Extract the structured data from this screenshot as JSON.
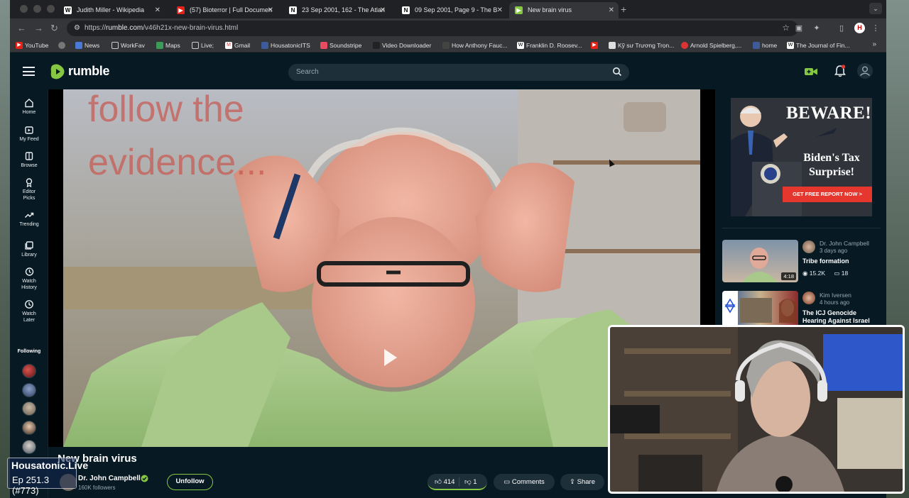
{
  "browser": {
    "tabs": [
      {
        "title": "Judith Miller - Wikipedia",
        "icon": "W"
      },
      {
        "title": "(57) Bioterror | Full Documen",
        "icon": "yt"
      },
      {
        "title": "23 Sep 2001, 162 - The Atlan",
        "icon": "N"
      },
      {
        "title": "09 Sep 2001, Page 9 - The B",
        "icon": "N"
      },
      {
        "title": "New brain virus",
        "icon": "rumble"
      }
    ],
    "url_prefix": "https://",
    "url_host": "rumble.com",
    "url_path": "/v46h21x-new-brain-virus.html",
    "profile_initial": "H",
    "bookmarks": [
      "YouTube",
      "",
      "News",
      "WorkFav",
      "Maps",
      "Live;",
      "Gmail",
      "HousatonicITS",
      "Soundstripe",
      "Video Downloader",
      "How Anthony Fauc...",
      "Franklin D. Roosev...",
      "",
      "Kỹ sư Trương Trọn...",
      "Arnold Spielberg,...",
      "home",
      "The Journal of Fin..."
    ]
  },
  "header": {
    "logo_text": "rumble",
    "search_placeholder": "Search"
  },
  "leftnav": {
    "items": [
      {
        "label": "Home",
        "icon": "home-icon"
      },
      {
        "label": "My Feed",
        "icon": "feed-icon"
      },
      {
        "label": "Browse",
        "icon": "browse-icon"
      },
      {
        "label": "Editor Picks",
        "icon": "editor-picks-icon"
      },
      {
        "label": "Trending",
        "icon": "trending-icon"
      },
      {
        "label": "Library",
        "icon": "library-icon"
      },
      {
        "label": "Watch History",
        "icon": "history-icon"
      },
      {
        "label": "Watch Later",
        "icon": "clock-icon"
      }
    ],
    "following_label": "Following"
  },
  "video": {
    "title": "New brain virus",
    "overlay_text_line1": "follow the",
    "overlay_text_line2": "evidence...",
    "channel_name": "Dr. John Campbell",
    "followers": "160K followers",
    "unfollow_label": "Unfollow",
    "likes": "414",
    "dislikes": "1",
    "comments_label": "Comments",
    "share_label": "Share"
  },
  "ad": {
    "headline": "BEWARE!",
    "body_line1": "Biden's Tax",
    "body_line2": "Surprise!",
    "cta": "GET FREE REPORT NOW >"
  },
  "sidebar_videos": [
    {
      "channel": "Dr. John Campbell",
      "ago": "3 days ago",
      "title": "Tribe formation",
      "views": "15.2K",
      "comments": "18",
      "duration": "4:18"
    },
    {
      "channel": "Kim Iversen",
      "ago": "4 hours ago",
      "title": "The ICJ Genocide Hearing Against Israel Has Begu...",
      "views": "",
      "comments": "",
      "duration": ""
    }
  ],
  "overlay_badge": {
    "line1": "Housatonic.Live",
    "line2": "Ep 251.3 (#773)"
  },
  "colors": {
    "rumble_green": "#85c742",
    "page_bg": "#071a24",
    "ad_red": "#e6372e"
  }
}
